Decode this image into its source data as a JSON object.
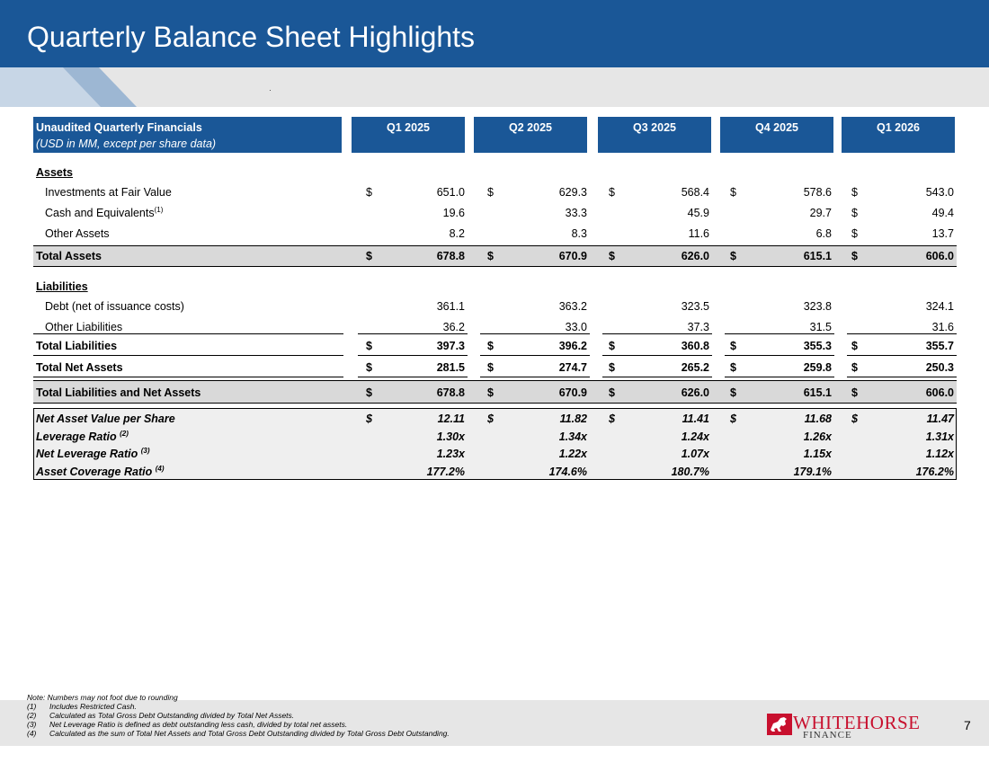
{
  "title": "Quarterly Balance Sheet Highlights",
  "table": {
    "header": {
      "label_line1": "Unaudited Quarterly Financials",
      "label_line2": "(USD in MM, except per share data)",
      "quarters": [
        "Q1 2025",
        "Q2 2025",
        "Q3 2025",
        "Q4 2025",
        "Q1 2026"
      ]
    },
    "assets": {
      "section_label": "Assets",
      "rows": [
        {
          "label": "Investments at Fair Value",
          "sup": "",
          "symbols": [
            "$",
            "$",
            "$",
            "$",
            "$"
          ],
          "values": [
            "651.0",
            "629.3",
            "568.4",
            "578.6",
            "543.0"
          ]
        },
        {
          "label": "Cash and Equivalents",
          "sup": "(1)",
          "symbols": [
            "",
            "",
            "",
            "",
            "$"
          ],
          "values": [
            "19.6",
            "33.3",
            "45.9",
            "29.7",
            "49.4"
          ]
        },
        {
          "label": "Other Assets",
          "sup": "",
          "symbols": [
            "",
            "",
            "",
            "",
            "$"
          ],
          "values": [
            "8.2",
            "8.3",
            "11.6",
            "6.8",
            "13.7"
          ]
        }
      ],
      "total": {
        "label": "Total Assets",
        "symbols": [
          "$",
          "$",
          "$",
          "$",
          "$"
        ],
        "values": [
          "678.8",
          "670.9",
          "626.0",
          "615.1",
          "606.0"
        ]
      }
    },
    "liabilities": {
      "section_label": "Liabilities",
      "rows": [
        {
          "label": "Debt (net of issuance costs)",
          "sup": "",
          "symbols": [
            "",
            "",
            "",
            "",
            ""
          ],
          "values": [
            "361.1",
            "363.2",
            "323.5",
            "323.8",
            "324.1"
          ]
        },
        {
          "label": "Other Liabilities",
          "sup": "",
          "symbols": [
            "",
            "",
            "",
            "",
            ""
          ],
          "values": [
            "36.2",
            "33.0",
            "37.3",
            "31.5",
            "31.6"
          ]
        }
      ],
      "total": {
        "label": "Total Liabilities",
        "symbols": [
          "$",
          "$",
          "$",
          "$",
          "$"
        ],
        "values": [
          "397.3",
          "396.2",
          "360.8",
          "355.3",
          "355.7"
        ]
      }
    },
    "net_assets": {
      "label": "Total Net Assets",
      "symbols": [
        "$",
        "$",
        "$",
        "$",
        "$"
      ],
      "values": [
        "281.5",
        "274.7",
        "265.2",
        "259.8",
        "250.3"
      ]
    },
    "total_liab_net": {
      "label": "Total Liabilities and Net Assets",
      "symbols": [
        "$",
        "$",
        "$",
        "$",
        "$"
      ],
      "values": [
        "678.8",
        "670.9",
        "626.0",
        "615.1",
        "606.0"
      ]
    },
    "ratios": [
      {
        "label": "Net Asset Value per Share",
        "sup": "",
        "symbols": [
          "$",
          "$",
          "$",
          "$",
          "$"
        ],
        "values": [
          "12.11",
          "11.82",
          "11.41",
          "11.68",
          "11.47"
        ]
      },
      {
        "label": "Leverage Ratio",
        "sup": "(2)",
        "symbols": [
          "",
          "",
          "",
          "",
          ""
        ],
        "values": [
          "1.30x",
          "1.34x",
          "1.24x",
          "1.26x",
          "1.31x"
        ]
      },
      {
        "label": "Net Leverage Ratio",
        "sup": "(3)",
        "symbols": [
          "",
          "",
          "",
          "",
          ""
        ],
        "values": [
          "1.23x",
          "1.22x",
          "1.07x",
          "1.15x",
          "1.12x"
        ]
      },
      {
        "label": "Asset Coverage Ratio",
        "sup": "(4)",
        "symbols": [
          "",
          "",
          "",
          "",
          ""
        ],
        "values": [
          "177.2%",
          "174.6%",
          "180.7%",
          "179.1%",
          "176.2%"
        ]
      }
    ]
  },
  "notes": [
    {
      "num": "",
      "text": "Note: Numbers may not foot due to rounding"
    },
    {
      "num": "(1)",
      "text": "Includes Restricted Cash."
    },
    {
      "num": "(2)",
      "text": "Calculated as Total Gross Debt Outstanding divided by Total Net Assets."
    },
    {
      "num": "(3)",
      "text": "Net Leverage Ratio is defined as debt outstanding less cash, divided by total net assets."
    },
    {
      "num": "(4)",
      "text": "Calculated as the sum of Total Net Assets and Total Gross Debt Outstanding divided by Total Gross Debt Outstanding."
    }
  ],
  "logo": {
    "word": "WHITEHORSE",
    "sub": "FINANCE"
  },
  "page_number": "7",
  "colors": {
    "header_blue": "#1a5797",
    "band_grey": "#e6e6e6",
    "total_shade": "#d9d9d9",
    "logo_red": "#c8102e"
  }
}
